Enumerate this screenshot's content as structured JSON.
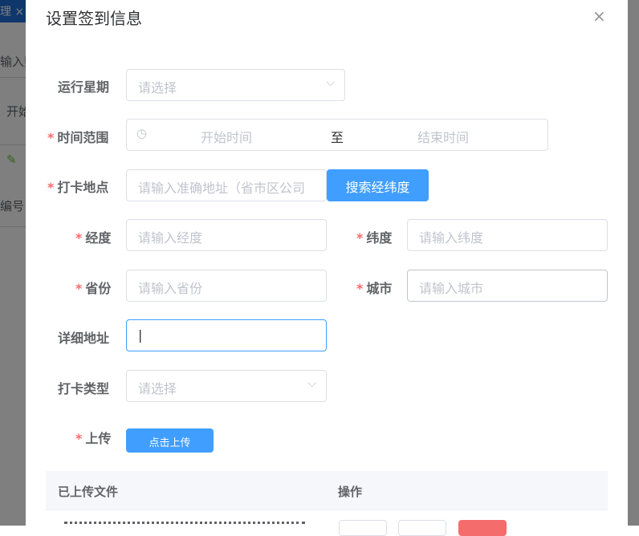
{
  "background": {
    "tab_label": "理",
    "tab_close": "×",
    "search_placeholder": "输入则",
    "date_text": "开始",
    "column": "编号"
  },
  "dialog": {
    "title": "设置签到信息",
    "close": "×"
  },
  "form": {
    "run_week": {
      "label": "运行星期",
      "placeholder": "请选择"
    },
    "time_range": {
      "label": "时间范围",
      "start": "开始时间",
      "separator": "至",
      "end": "结束时间"
    },
    "location": {
      "label": "打卡地点",
      "placeholder": "请输入准确地址（省市区公司",
      "search_button": "搜索经纬度"
    },
    "longitude": {
      "label": "经度",
      "placeholder": "请输入经度"
    },
    "latitude": {
      "label": "纬度",
      "placeholder": "请输入纬度"
    },
    "province": {
      "label": "省份",
      "placeholder": "请输入省份"
    },
    "city": {
      "label": "城市",
      "placeholder": "请输入城市"
    },
    "address": {
      "label": "详细地址",
      "value": "|"
    },
    "clock_type": {
      "label": "打卡类型",
      "placeholder": "请选择"
    },
    "upload": {
      "label": "上传",
      "button": "点击上传"
    }
  },
  "table": {
    "headers": [
      "已上传文件",
      "操作"
    ]
  },
  "required_mark": "*"
}
